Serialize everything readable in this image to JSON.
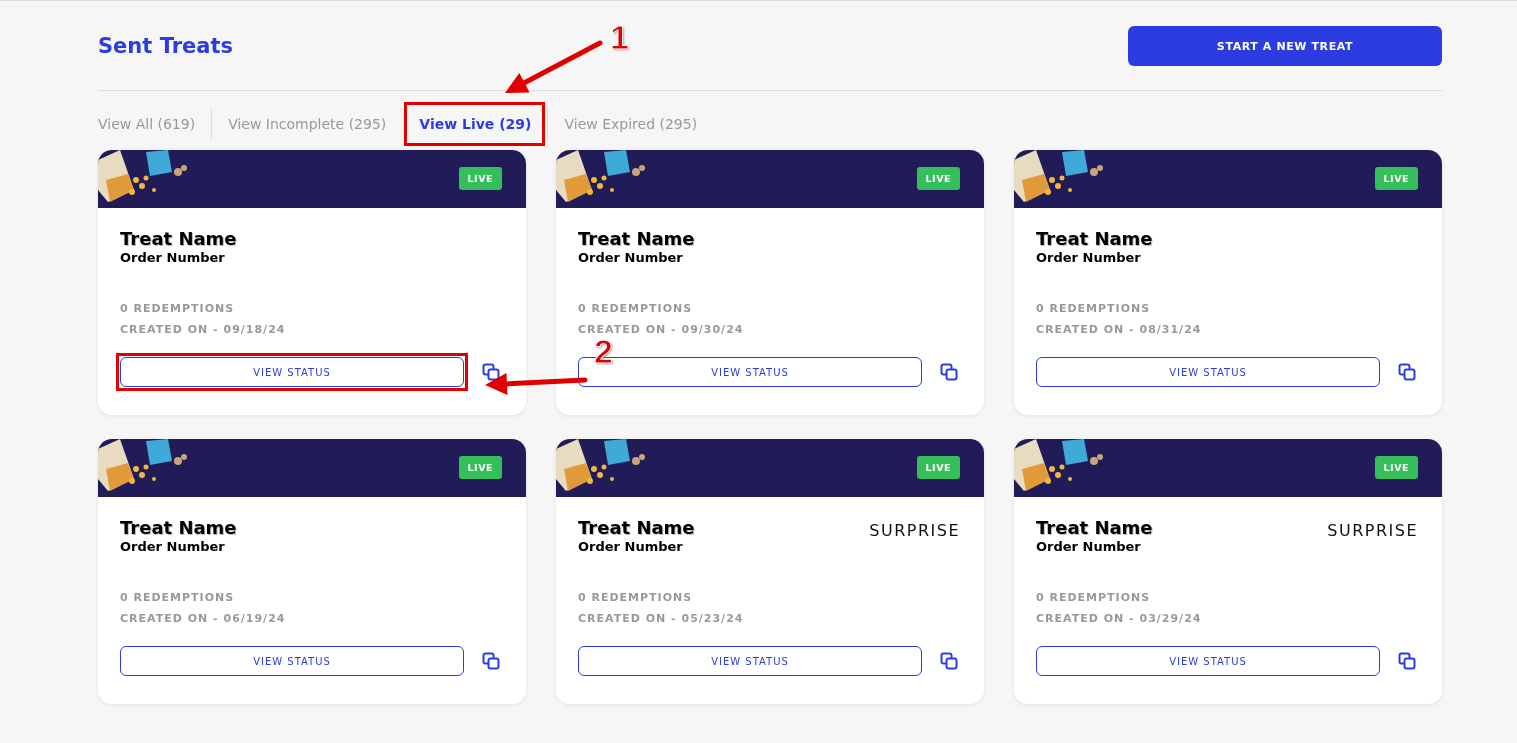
{
  "page_title": "Sent Treats",
  "primary_button": "START A NEW TREAT",
  "tabs": [
    {
      "label": "View All (619)",
      "selected": false,
      "highlighted": false
    },
    {
      "label": "View Incomplete (295)",
      "selected": false,
      "highlighted": false
    },
    {
      "label": "View Live (29)",
      "selected": true,
      "highlighted": true
    },
    {
      "label": "View Expired (295)",
      "selected": false,
      "highlighted": false
    }
  ],
  "cards": [
    {
      "badge": "LIVE",
      "name": "Treat Name",
      "order": "Order Number",
      "redemptions": "0 REDEMPTIONS",
      "created": "CREATED ON - 09/18/24",
      "button": "VIEW STATUS",
      "highlighted": true
    },
    {
      "badge": "LIVE",
      "name": "Treat Name",
      "order": "Order Number",
      "redemptions": "0 REDEMPTIONS",
      "created": "CREATED ON - 09/30/24",
      "button": "VIEW STATUS",
      "highlighted": false
    },
    {
      "badge": "LIVE",
      "name": "Treat Name",
      "order": "Order Number",
      "redemptions": "0 REDEMPTIONS",
      "created": "CREATED ON - 08/31/24",
      "button": "VIEW STATUS",
      "highlighted": false
    },
    {
      "badge": "LIVE",
      "name": "Treat Name",
      "order": "Order Number",
      "redemptions": "0 REDEMPTIONS",
      "created": "CREATED ON - 06/19/24",
      "button": "VIEW STATUS",
      "highlighted": false
    },
    {
      "badge": "LIVE",
      "name": "Treat Name",
      "order": "Order Number",
      "tag": "SURPRISE",
      "redemptions": "0 REDEMPTIONS",
      "created": "CREATED ON - 05/23/24",
      "button": "VIEW STATUS",
      "highlighted": false
    },
    {
      "badge": "LIVE",
      "name": "Treat Name",
      "order": "Order Number",
      "tag": "SURPRISE",
      "redemptions": "0 REDEMPTIONS",
      "created": "CREATED ON - 03/29/24",
      "button": "VIEW STATUS",
      "highlighted": false
    }
  ],
  "annotations": [
    {
      "label": "1"
    },
    {
      "label": "2"
    }
  ]
}
